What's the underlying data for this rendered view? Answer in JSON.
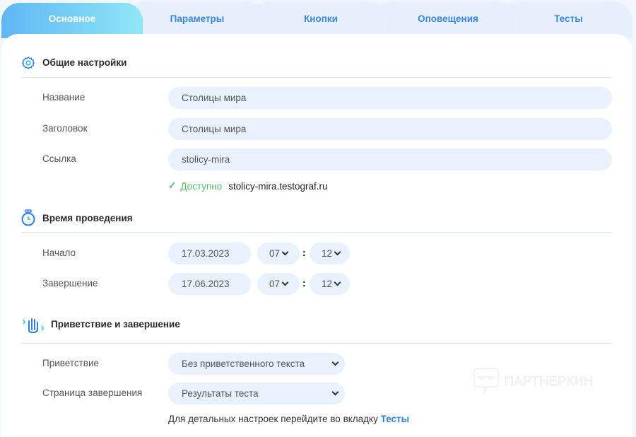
{
  "tabs": [
    "Основное",
    "Параметры",
    "Кнопки",
    "Оповещения",
    "Тесты"
  ],
  "general": {
    "title": "Общие настройки",
    "name_label": "Название",
    "name_value": "Столицы мира",
    "heading_label": "Заголовок",
    "heading_value": "Столицы мира",
    "link_label": "Ссылка",
    "link_value": "stolicy-mira",
    "available_label": "Доступно",
    "available_url": "stolicy-mira.testograf.ru"
  },
  "time": {
    "title": "Время проведения",
    "start_label": "Начало",
    "start_date": "17.03.2023",
    "start_hour": "07",
    "start_minute": "12",
    "end_label": "Завершение",
    "end_date": "17.06.2023",
    "end_hour": "07",
    "end_minute": "12",
    "colon": ":"
  },
  "greeting": {
    "title": "Приветствие и завершение",
    "greeting_label": "Приветствие",
    "greeting_value": "Без приветственного текста",
    "finish_label": "Страница завершения",
    "finish_value": "Результаты теста",
    "hint": "Для детальных настроек перейдите во вкладку",
    "hint_link": "Тесты"
  },
  "watermark": "ПАРТНЕРКИН"
}
